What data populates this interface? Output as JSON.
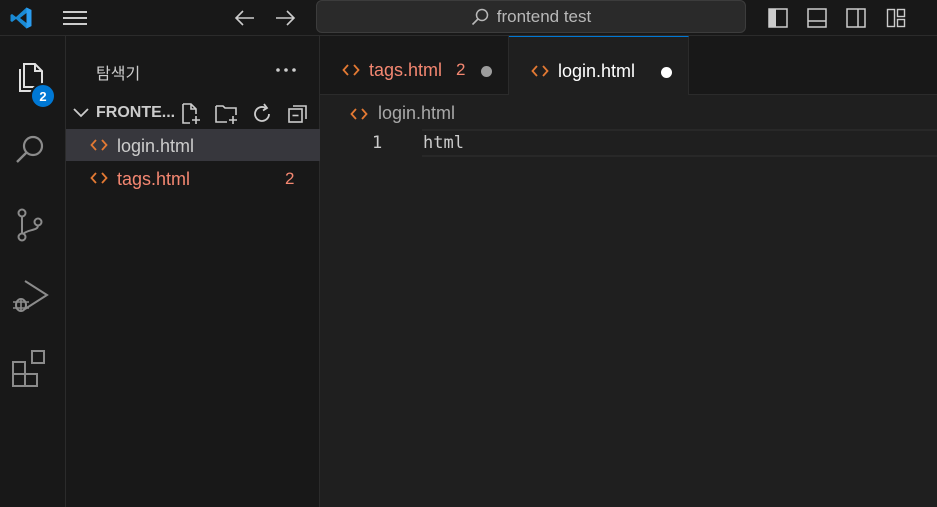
{
  "titlebar": {
    "search_text": "frontend test"
  },
  "activity": {
    "explorer_badge": "2"
  },
  "sidebar": {
    "title": "탐색기",
    "folder_name": "FRONTE...",
    "files": [
      {
        "name": "login.html",
        "count": "",
        "color": "#cccccc"
      },
      {
        "name": "tags.html",
        "count": "2",
        "color": "#f48771"
      }
    ]
  },
  "tabs": [
    {
      "name": "tags.html",
      "count": "2",
      "color": "#f48771",
      "dot_color": "#9d9d9d"
    },
    {
      "name": "login.html",
      "count": "",
      "color": "#ffffff",
      "dot_color": "#ffffff"
    }
  ],
  "breadcrumb": {
    "file": "login.html"
  },
  "editor": {
    "line_number": "1",
    "code": "html"
  },
  "colors": {
    "accent": "#0078d4",
    "html_icon": "#e37933",
    "error": "#f48771"
  }
}
